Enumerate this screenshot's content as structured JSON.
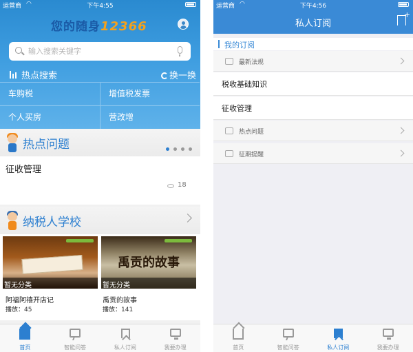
{
  "left": {
    "status": {
      "carrier": "运营商",
      "time": "下午4:55"
    },
    "brand": {
      "prefix": "您的随身",
      "number": "12366"
    },
    "search": {
      "placeholder": "输入搜索关键字"
    },
    "hot_search": {
      "title": "热点搜索",
      "refresh_label": "换一换",
      "items": [
        "车购税",
        "增值税发票",
        "个人买房",
        "营改增"
      ]
    },
    "hot_issues": {
      "title": "热点问题",
      "item": "征收管理",
      "views": "18"
    },
    "school": {
      "title": "纳税人学校",
      "videos": [
        {
          "category": "暂无分类",
          "title": "阿福阿禧开店记",
          "plays": "播放：45"
        },
        {
          "category": "暂无分类",
          "title": "禹贡的故事",
          "plays": "播放：141",
          "calligraphy": "禹贡的故事"
        }
      ]
    },
    "tabs": [
      {
        "label": "首页",
        "icon": "home-icon",
        "active": true
      },
      {
        "label": "智能问答",
        "icon": "chat-icon",
        "active": false
      },
      {
        "label": "私人订阅",
        "icon": "bookmark-icon",
        "active": false
      },
      {
        "label": "我要办理",
        "icon": "screen-icon",
        "active": false
      }
    ]
  },
  "right": {
    "status": {
      "carrier": "运营商",
      "time": "下午4:56"
    },
    "nav_title": "私人订阅",
    "section_title": "我的订阅",
    "rows": [
      {
        "kind": "group",
        "label": "最新法规"
      },
      {
        "kind": "item",
        "label": "税收基础知识"
      },
      {
        "kind": "item",
        "label": "征收管理"
      },
      {
        "kind": "group",
        "label": "热点问题"
      },
      {
        "kind": "group",
        "label": "征期提醒"
      }
    ],
    "tabs": [
      {
        "label": "首页",
        "icon": "home-icon",
        "active": false
      },
      {
        "label": "智能问答",
        "icon": "chat-icon",
        "active": false
      },
      {
        "label": "私人订阅",
        "icon": "bookmark-icon",
        "active": true
      },
      {
        "label": "我要办理",
        "icon": "screen-icon",
        "active": false
      }
    ]
  },
  "colors": {
    "primary": "#2c7fd0",
    "nav": "#3a8ad6",
    "brand_number": "#f5a21b"
  }
}
